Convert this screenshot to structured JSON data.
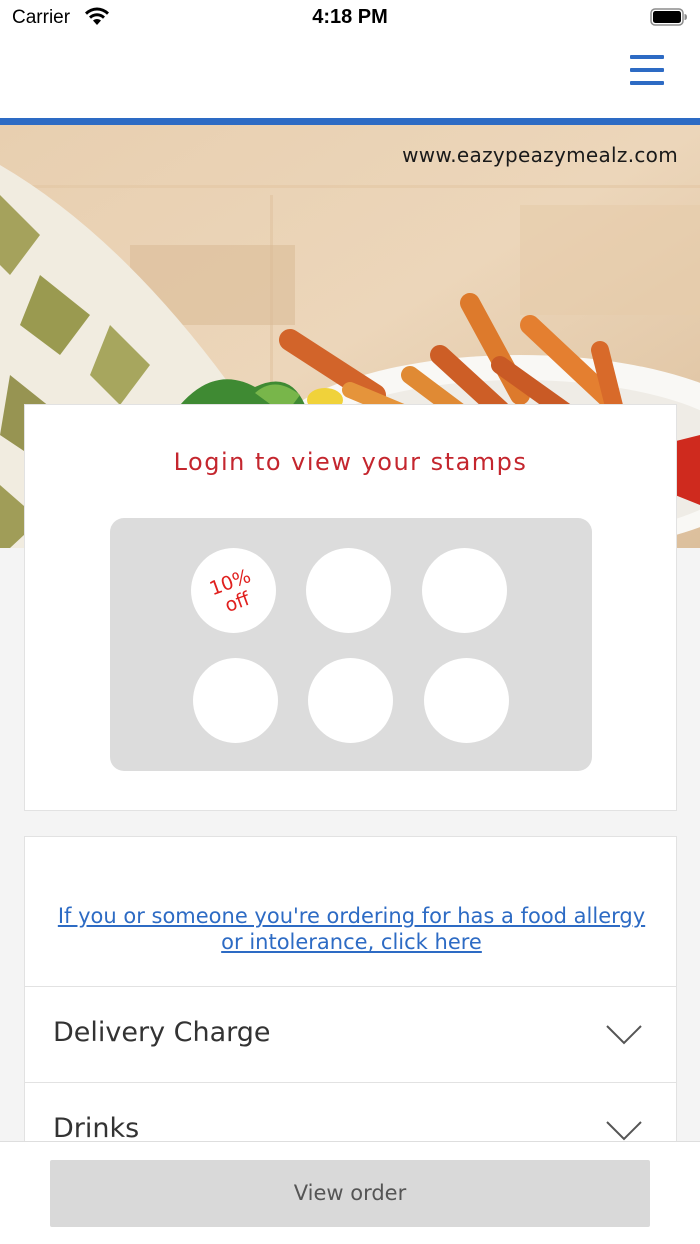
{
  "status_bar": {
    "carrier": "Carrier",
    "time": "4:18 PM"
  },
  "hero": {
    "website": "www.eazypeazymealz.com"
  },
  "stamps": {
    "title": "Login to view your stamps",
    "reward_label": "10%\noff",
    "total_slots": 6
  },
  "allergy": {
    "link_text": "If you or someone you're ordering for has a food allergy or intolerance, click here"
  },
  "categories": [
    {
      "label": "Delivery Charge"
    },
    {
      "label": "Drinks"
    }
  ],
  "footer": {
    "view_order_label": "View order"
  },
  "colors": {
    "accent_blue": "#2d6bc4",
    "stamp_red": "#c4262e",
    "reward_red": "#e0201e"
  }
}
